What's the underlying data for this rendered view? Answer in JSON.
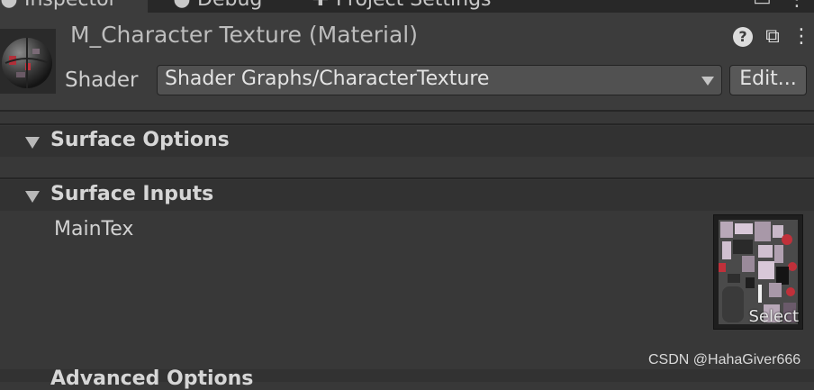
{
  "tabs": [
    {
      "label": "Inspector",
      "icon": "info-icon"
    },
    {
      "label": "Debug",
      "icon": "bug-icon"
    },
    {
      "label": "Project Settings",
      "icon": "gear-icon"
    }
  ],
  "material": {
    "title": "M_Character Texture (Material)",
    "shader_label": "Shader",
    "shader_value": "Shader Graphs/CharacterTexture",
    "edit_label": "Edit..."
  },
  "sections": {
    "surface_options": "Surface Options",
    "surface_inputs": "Surface Inputs",
    "advanced_options": "Advanced Options"
  },
  "properties": {
    "main_tex_label": "MainTex",
    "texture_select_label": "Select"
  },
  "watermark": "CSDN @HahaGiver666",
  "colors": {
    "background": "#383838",
    "header": "#3c3c3c",
    "section_header": "#323232",
    "accent_red": "#c0303a"
  }
}
